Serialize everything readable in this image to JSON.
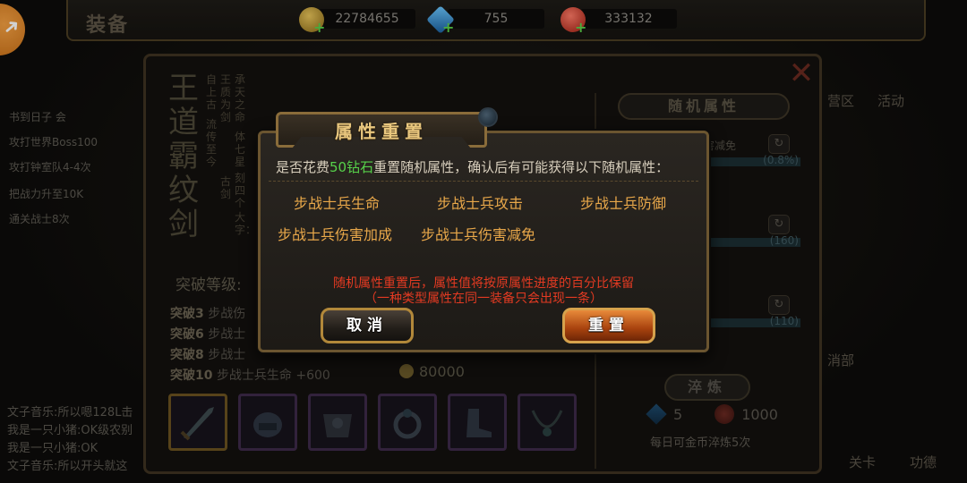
{
  "topbar": {
    "title": "装备",
    "resources": [
      {
        "name": "gold",
        "icon": "gold-coin-icon",
        "value": "22784655"
      },
      {
        "name": "diamond",
        "icon": "blue-diamond-icon",
        "value": "755"
      },
      {
        "name": "ruby",
        "icon": "red-gem-icon",
        "value": "333132"
      }
    ]
  },
  "background": {
    "item_name": "王道霸纹剑",
    "item_lore_columns": [
      "承天之命",
      "王质为剑",
      "体七星",
      "刻四个",
      "大字：",
      "自上古",
      "流传至今",
      "古剑"
    ],
    "breakthrough_label": "突破等级:",
    "breakthrough_rows": [
      {
        "level": "突破3",
        "text": "步战伤"
      },
      {
        "level": "突破6",
        "text": "步战士"
      },
      {
        "level": "突破8",
        "text": "步战士"
      },
      {
        "level": "突破10",
        "text": "步战士兵生命 +600"
      }
    ],
    "cost_gold": "80000",
    "side_title": "随机属性",
    "side_rows": [
      {
        "label": "害减免",
        "value": "(0.8%)"
      },
      {
        "label": "",
        "value": "(160)"
      },
      {
        "label": "",
        "value": "(110)"
      }
    ],
    "refine_label": "淬炼",
    "refine_cost_diamond": "5",
    "refine_cost_ruby": "1000",
    "daily_note": "每日可金币淬炼5次",
    "chat_lines": [
      "文子音乐:所以嗯128L击",
      "我是一只小猪:OK级农别",
      "我是一只小猪:OK",
      "文子音乐:所以开头就这"
    ],
    "left_ghost_lines": [
      "书到日子 会",
      "攻打世界Boss100",
      "攻打钟室队4-4次",
      "把战力升至10K",
      "通关战士8次"
    ],
    "right_ghost_labels": [
      "营区",
      "活动",
      "消部",
      "关卡",
      "功德"
    ]
  },
  "dialog": {
    "title": "属性重置",
    "prompt_prefix": "是否花费",
    "prompt_highlight": "50钻石",
    "prompt_suffix": "重置随机属性，确认后有可能获得以下随机属性：",
    "attributes": [
      "步战士兵生命",
      "步战士兵攻击",
      "步战士兵防御",
      "步战士兵伤害加成",
      "步战士兵伤害减免"
    ],
    "notice_line1": "随机属性重置后，属性值将按原属性进度的百分比保留",
    "notice_line2": "（一种类型属性在同一装备只会出现一条）",
    "cancel_label": "取消",
    "reset_label": "重置"
  },
  "colors": {
    "attribute_text": "#e9a84a",
    "notice_text": "#e33a22",
    "highlight_green": "#56d14a",
    "title_gold": "#e9c77e"
  }
}
